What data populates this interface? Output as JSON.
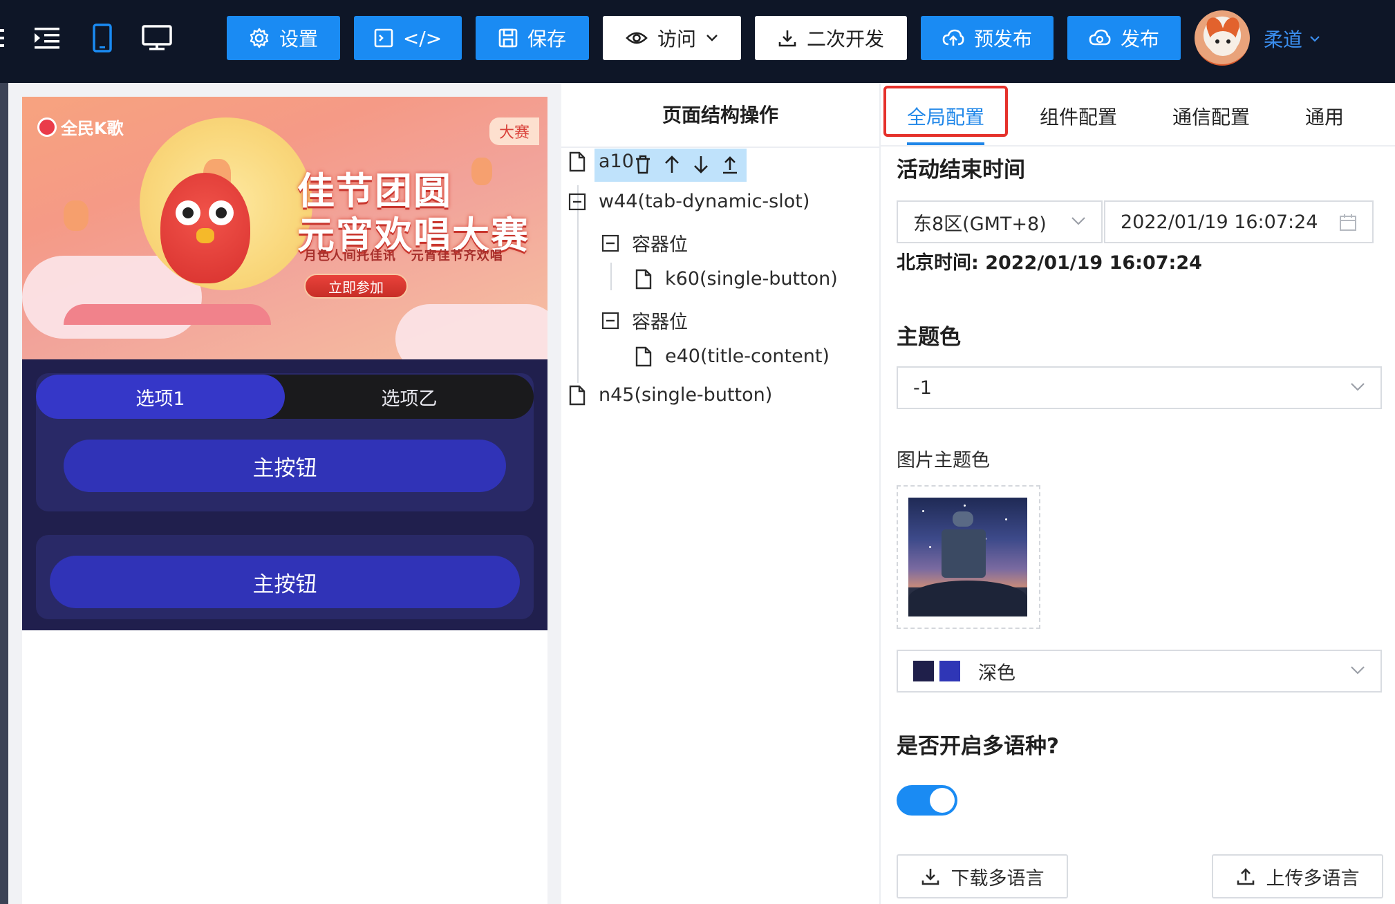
{
  "toolbar": {
    "settings": "设置",
    "code": "</>",
    "save": "保存",
    "visit": "访问",
    "dev": "二次开发",
    "prepublish": "预发布",
    "publish": "发布",
    "username": "柔道"
  },
  "colors": {
    "topbar": "#0e1627",
    "primary": "#1a8bf3",
    "highlight": "#e5312b",
    "tab_active": "#3537c8",
    "swatch_dark": "#1f1f4a",
    "swatch_blue": "#2f36b6"
  },
  "preview": {
    "banner": {
      "logo": "全民K歌",
      "badge": "大赛",
      "title_line1": "佳节团圆",
      "title_line2": "元宵欢唱大赛",
      "subtitle": "月色人间托佳讯   元宵佳节齐欢唱",
      "cta": "立即参加"
    },
    "tabs": [
      "选项1",
      "选项乙"
    ],
    "button1": "主按钮",
    "button2": "主按钮"
  },
  "structure": {
    "title": "页面结构操作",
    "nodes": [
      {
        "label": "a10"
      },
      {
        "label": "w44(tab-dynamic-slot)"
      },
      {
        "label": "容器位"
      },
      {
        "label": "k60(single-button)"
      },
      {
        "label": "容器位"
      },
      {
        "label": "e40(title-content)"
      },
      {
        "label": "n45(single-button)"
      }
    ]
  },
  "config": {
    "tabs": [
      "全局配置",
      "组件配置",
      "通信配置",
      "通用"
    ],
    "end_time_label": "活动结束时间",
    "timezone": "东8区(GMT+8)",
    "datetime": "2022/01/19 16:07:24",
    "beijing_time": "北京时间: 2022/01/19 16:07:24",
    "theme_label": "主题色",
    "theme_value": "-1",
    "image_theme_label": "图片主题色",
    "image_theme_value": "深色",
    "multilang_label": "是否开启多语种?",
    "multilang_on": true,
    "download_btn": "下载多语言",
    "upload_btn": "上传多语言"
  }
}
